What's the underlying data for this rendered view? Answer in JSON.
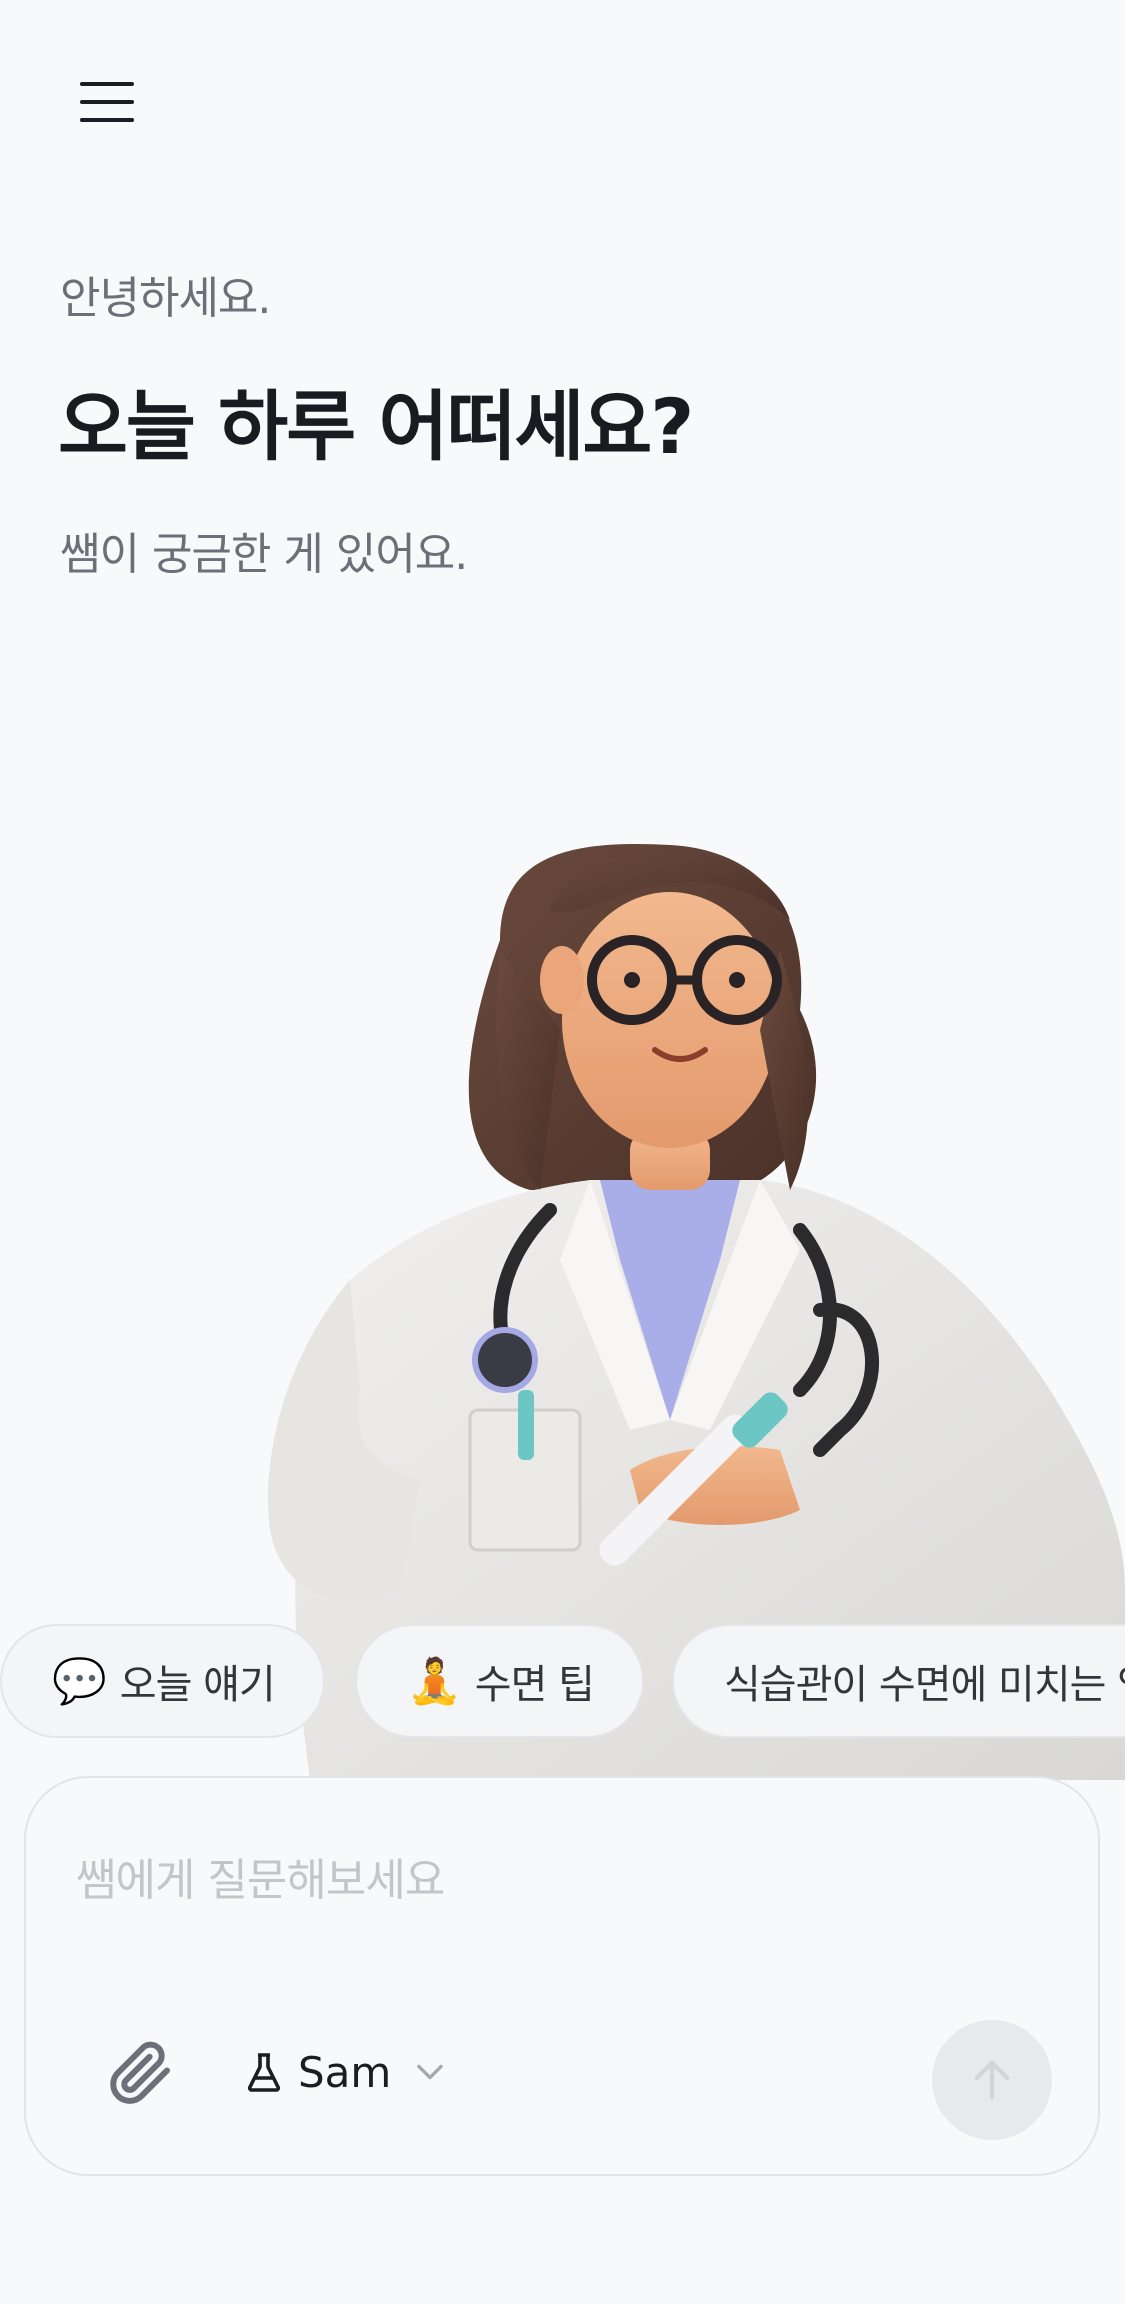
{
  "header": {
    "menu_icon": "hamburger-menu-icon"
  },
  "greeting": {
    "small": "안녕하세요.",
    "title": "오늘 하루 어떠세요?",
    "subtitle": "쌤이 궁금한 게 있어요."
  },
  "suggestions": [
    {
      "emoji": "💬",
      "label": "오늘 얘기"
    },
    {
      "emoji": "🧘",
      "label": "수면 팁"
    },
    {
      "emoji": "",
      "label": "식습관이 수면에 미치는 영향"
    }
  ],
  "composer": {
    "placeholder": "쌤에게 질문해보세요",
    "value": "",
    "model_label": "Sam",
    "icons": {
      "attach": "paperclip-icon",
      "model": "flask-icon",
      "dropdown": "chevron-down-icon",
      "send": "arrow-up-icon"
    }
  },
  "colors": {
    "background": "#f8f9fb",
    "title": "#1a1b20",
    "muted": "#6c6f78",
    "placeholder": "#c3c5cb",
    "send_disabled": "#e8e9ed"
  }
}
